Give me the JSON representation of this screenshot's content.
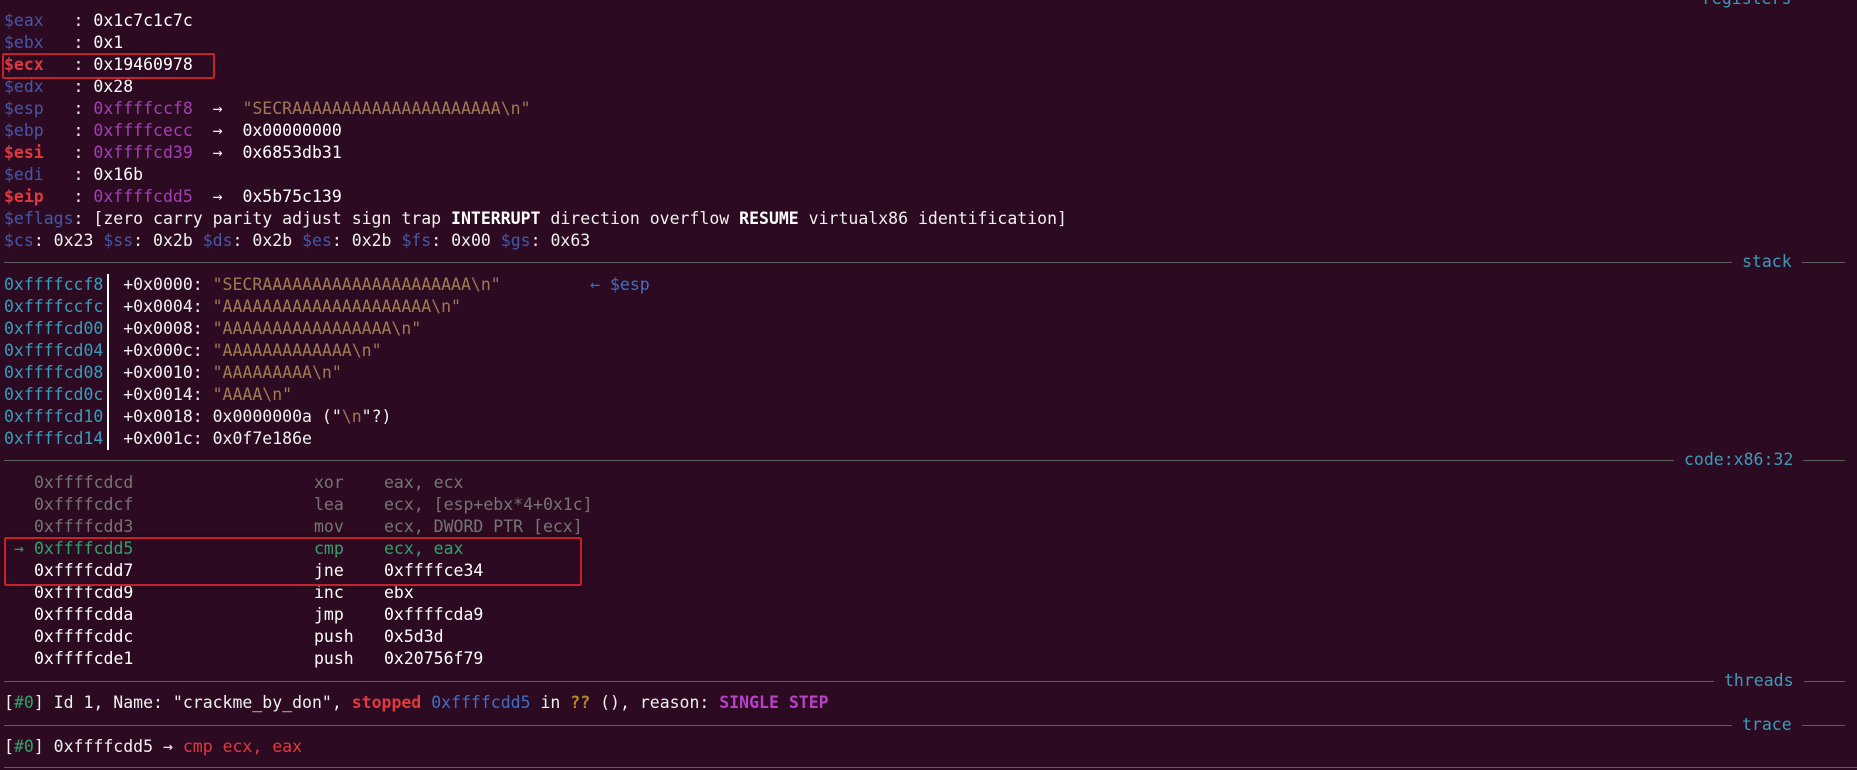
{
  "headers": {
    "registers": "registers",
    "stack": "stack",
    "code": "code:x86:32",
    "threads": "threads",
    "trace": "trace"
  },
  "registers": [
    {
      "name": "$eax",
      "sep": "   : ",
      "value": "0x1c7c1c7c"
    },
    {
      "name": "$ebx",
      "sep": "   : ",
      "value": "0x1"
    },
    {
      "name": "$ecx",
      "sep": "   : ",
      "value": "0x19460978"
    },
    {
      "name": "$edx",
      "sep": "   : ",
      "value": "0x28"
    },
    {
      "name": "$esp",
      "sep": "   : ",
      "value": "0xffffccf8",
      "arrow": "  →  ",
      "target": "\"SECRAAAAAAAAAAAAAAAAAAAAA\\n\""
    },
    {
      "name": "$ebp",
      "sep": "   : ",
      "value": "0xffffcecc",
      "arrow": "  →  ",
      "target": "0x00000000"
    },
    {
      "name": "$esi",
      "sep": "   : ",
      "value": "0xffffcd39",
      "arrow": "  →  ",
      "target": "0x6853db31"
    },
    {
      "name": "$edi",
      "sep": "   : ",
      "value": "0x16b"
    },
    {
      "name": "$eip",
      "sep": "   : ",
      "value": "0xffffcdd5",
      "arrow": "  →  ",
      "target": "0x5b75c139"
    }
  ],
  "eflags": {
    "name": "$eflags",
    "open": ": [zero carry parity adjust sign trap ",
    "interrupt": "INTERRUPT",
    "mid": " direction overflow ",
    "resume": "RESUME",
    "close": " virtualx86 identification]"
  },
  "segments": {
    "cs": "$cs",
    "cs_v": ": 0x23 ",
    "ss": "$ss",
    "ss_v": ": 0x2b ",
    "ds": "$ds",
    "ds_v": ": 0x2b ",
    "es": "$es",
    "es_v": ": 0x2b ",
    "fs": "$fs",
    "fs_v": ": 0x00 ",
    "gs": "$gs",
    "gs_v": ": 0x63"
  },
  "stack": [
    {
      "addr": "0xffffccf8",
      "off": "+0x0000: ",
      "val": "\"SECRAAAAAAAAAAAAAAAAAAAAA\\n\"",
      "note": "← $esp"
    },
    {
      "addr": "0xffffccfc",
      "off": "+0x0004: ",
      "val": "\"AAAAAAAAAAAAAAAAAAAAA\\n\""
    },
    {
      "addr": "0xffffcd00",
      "off": "+0x0008: ",
      "val": "\"AAAAAAAAAAAAAAAAA\\n\""
    },
    {
      "addr": "0xffffcd04",
      "off": "+0x000c: ",
      "val": "\"AAAAAAAAAAAAA\\n\""
    },
    {
      "addr": "0xffffcd08",
      "off": "+0x0010: ",
      "val": "\"AAAAAAAAA\\n\""
    },
    {
      "addr": "0xffffcd0c",
      "off": "+0x0014: ",
      "val": "\"AAAA\\n\""
    },
    {
      "addr": "0xffffcd10",
      "off": "+0x0018: ",
      "val": "0x0000000a (\"",
      "nl": "\\n",
      "val2": "\"?)"
    },
    {
      "addr": "0xffffcd14",
      "off": "+0x001c: ",
      "val": "0x0f7e186e"
    }
  ],
  "code": [
    {
      "addr": "0xffffcdcd",
      "op": "xor",
      "args": "eax, ecx"
    },
    {
      "addr": "0xffffcdcf",
      "op": "lea",
      "args": "ecx, [esp+ebx*4+0x1c]"
    },
    {
      "addr": "0xffffcdd3",
      "op": "mov",
      "args": "ecx, DWORD PTR [ecx]"
    },
    {
      "addr": "0xffffcdd5",
      "op": "cmp",
      "args": "ecx, eax"
    },
    {
      "addr": "0xffffcdd7",
      "op": "jne",
      "args": "0xffffce34"
    },
    {
      "addr": "0xffffcdd9",
      "op": "inc",
      "args": "ebx"
    },
    {
      "addr": "0xffffcdda",
      "op": "jmp",
      "args": "0xffffcda9"
    },
    {
      "addr": "0xffffcddc",
      "op": "push",
      "args": "0x5d3d"
    },
    {
      "addr": "0xffffcde1",
      "op": "push",
      "args": "0x20756f79"
    }
  ],
  "current_arrow": "→",
  "threads": {
    "open": "[",
    "num": "#0",
    "text1": "] Id 1, Name: \"crackme_by_don\", ",
    "stopped": "stopped",
    "space1": " ",
    "addr": "0xffffcdd5",
    "in": " in ",
    "qq": "??",
    "text2": " (), reason: ",
    "reason": "SINGLE STEP"
  },
  "trace": {
    "open": "[",
    "num": "#0",
    "text1": "] 0xffffcdd5 → ",
    "instr": "cmp ecx, eax"
  }
}
